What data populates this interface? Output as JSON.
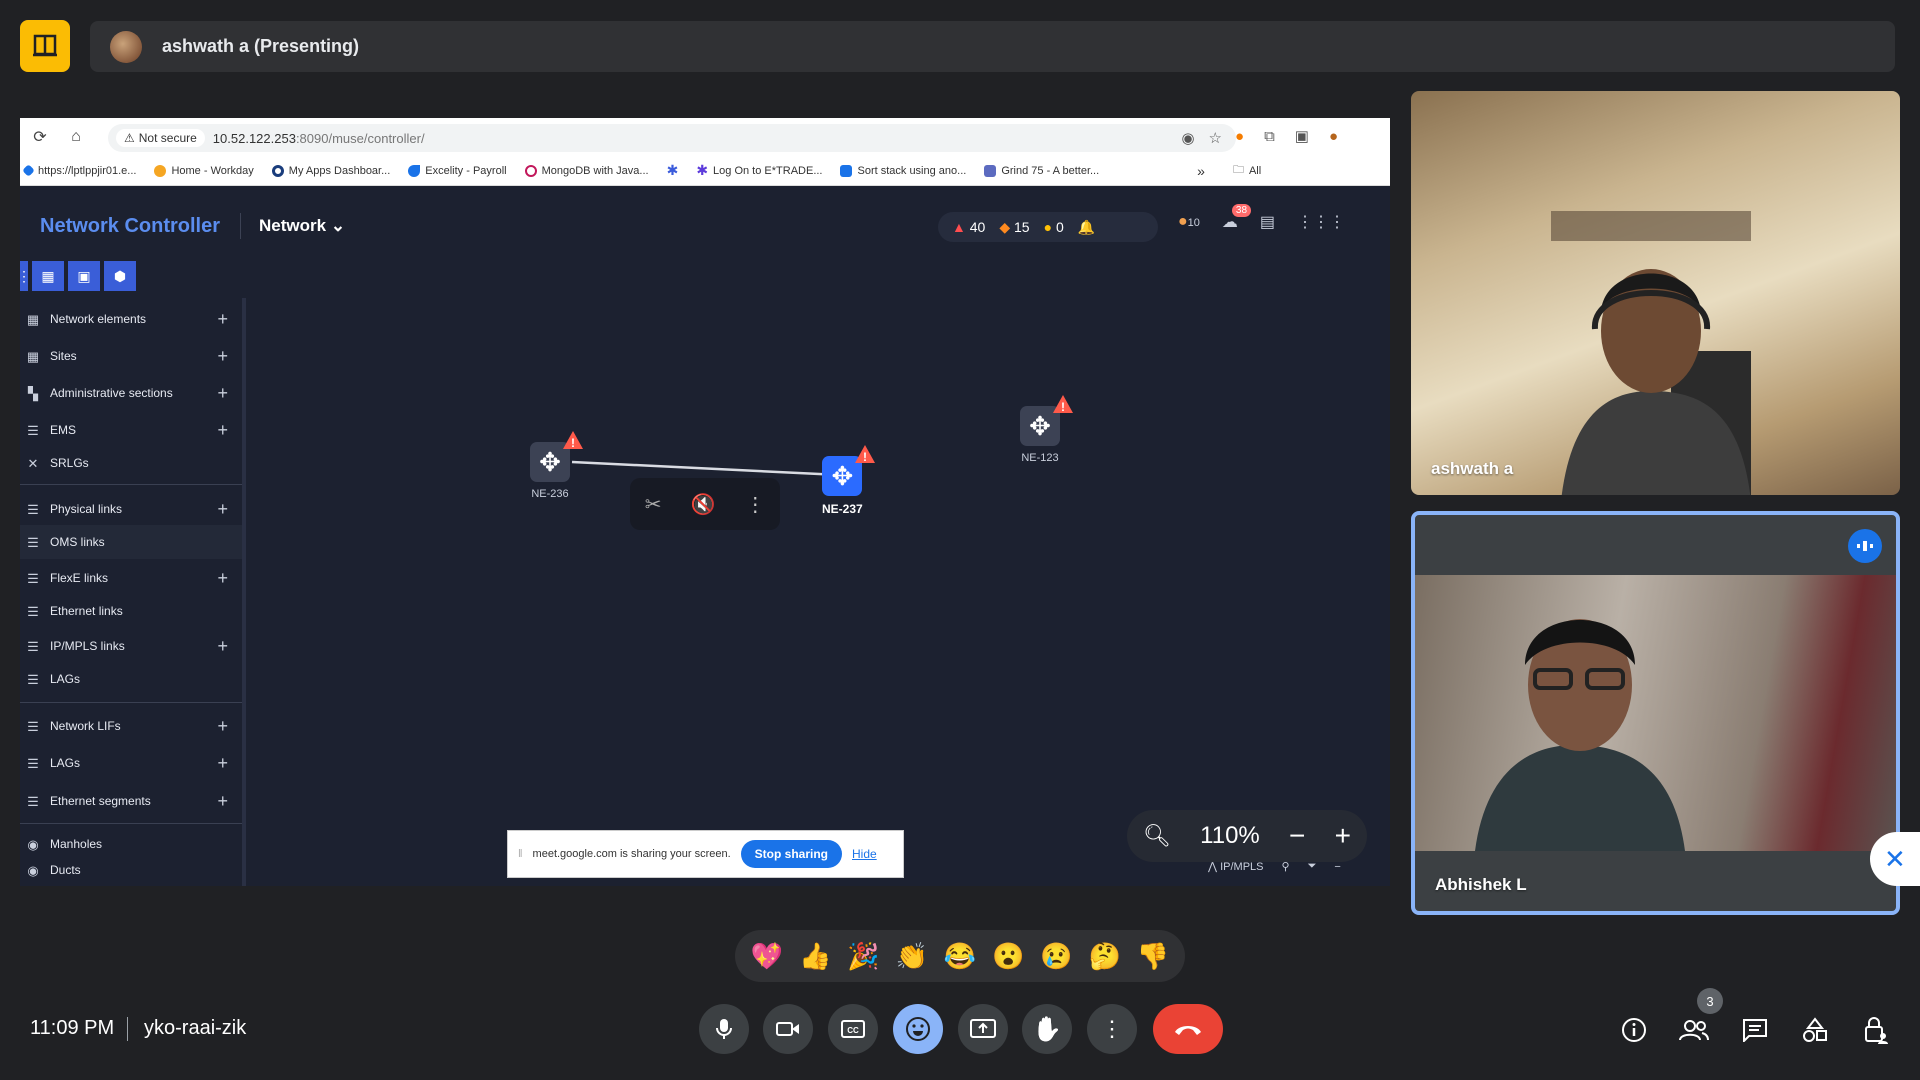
{
  "presenting": {
    "label": "ashwath a (Presenting)"
  },
  "browser": {
    "not_secure": "Not secure",
    "url_host": "10.52.122.253",
    "url_path": ":8090/muse/controller/",
    "bookmarks": [
      {
        "label": "https://lptlppjir01.e...",
        "icon_color": "#1a73e8"
      },
      {
        "label": "Home - Workday",
        "icon_color": "#f5a623"
      },
      {
        "label": "My Apps Dashboar...",
        "icon_color": "#1a3d7c"
      },
      {
        "label": "Excelity - Payroll",
        "icon_color": "#1a73e8"
      },
      {
        "label": "MongoDB with Java...",
        "icon_color": "#c2185b"
      },
      {
        "label": "",
        "icon_color": "#3b5bdb"
      },
      {
        "label": "Log On to E*TRADE...",
        "icon_color": "#5c3bdb"
      },
      {
        "label": "Sort stack using ano...",
        "icon_color": "#1a73e8"
      },
      {
        "label": "Grind 75 - A better...",
        "icon_color": "#5c6bc0"
      }
    ],
    "more": "»",
    "all_bookmarks": "All"
  },
  "app": {
    "title": "Network Controller",
    "dropdown": "Network",
    "alarms": {
      "critical": "40",
      "major": "15",
      "minor": "0"
    },
    "user_count": "10",
    "notif_badge": "38"
  },
  "sidebar": {
    "items": [
      {
        "label": "Network elements",
        "icon": "grid-icon",
        "plus": true
      },
      {
        "label": "Sites",
        "icon": "grid-icon",
        "plus": true
      },
      {
        "label": "Administrative sections",
        "icon": "blocks-icon",
        "plus": true
      },
      {
        "label": "EMS",
        "icon": "list-icon",
        "plus": true
      },
      {
        "label": "SRLGs",
        "icon": "cross-icon",
        "plus": false
      },
      {
        "label": "Physical links",
        "icon": "link-icon",
        "plus": true
      },
      {
        "label": "OMS links",
        "icon": "link-icon",
        "plus": false
      },
      {
        "label": "FlexE links",
        "icon": "link-icon",
        "plus": true
      },
      {
        "label": "Ethernet links",
        "icon": "link-icon",
        "plus": false
      },
      {
        "label": "IP/MPLS links",
        "icon": "link-icon",
        "plus": true
      },
      {
        "label": "LAGs",
        "icon": "link-icon",
        "plus": false
      },
      {
        "label": "Network LIFs",
        "icon": "link-icon",
        "plus": true
      },
      {
        "label": "LAGs",
        "icon": "link-icon",
        "plus": true
      },
      {
        "label": "Ethernet segments",
        "icon": "link-icon",
        "plus": true
      },
      {
        "label": "Manholes",
        "icon": "circle-icon",
        "plus": false
      },
      {
        "label": "Ducts",
        "icon": "circle-icon",
        "plus": false
      }
    ]
  },
  "canvas": {
    "nodes": [
      {
        "label": "NE-236"
      },
      {
        "label": "NE-237"
      },
      {
        "label": "NE-123"
      }
    ],
    "zoom": "110%",
    "layer": "IP/MPLS"
  },
  "share_notice": {
    "text": "meet.google.com is sharing your screen.",
    "stop": "Stop sharing",
    "hide": "Hide"
  },
  "participants": [
    {
      "name": "ashwath a"
    },
    {
      "name": "Abhishek L"
    }
  ],
  "reactions": [
    "💖",
    "👍",
    "🎉",
    "👏",
    "😂",
    "😮",
    "😢",
    "🤔",
    "👎"
  ],
  "meeting": {
    "time": "11:09 PM",
    "code": "yko-raai-zik",
    "participant_count": "3"
  }
}
